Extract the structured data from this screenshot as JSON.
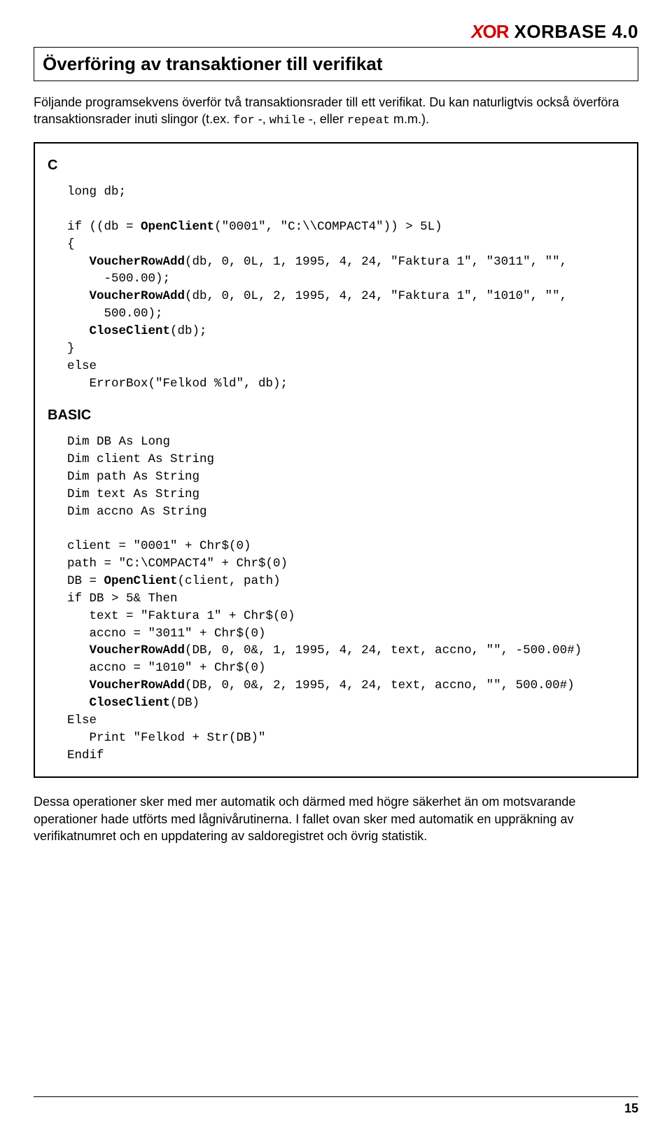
{
  "header": {
    "logo_text": "XOR",
    "product": "XORBASE 4.0"
  },
  "title": "Överföring av transaktioner till verifikat",
  "intro_prefix": "Följande programsekvens överför två transaktionsrader till ett verifikat. Du kan naturligtvis också överföra transaktionsrader inuti slingor (t.ex. ",
  "intro_tokens": {
    "for": "for",
    "while": "while",
    "repeat": "repeat"
  },
  "intro_sep1": " -, ",
  "intro_sep2": " -, eller ",
  "intro_suffix": "  m.m.).",
  "code_c_label": "C",
  "code_c": "long db;\n\nif ((db = <b>OpenClient</b>(\"0001\", \"C:\\\\COMPACT4\")) > 5L)\n{\n   <b>VoucherRowAdd</b>(db, 0, 0L, 1, 1995, 4, 24, \"Faktura 1\", \"3011\", \"\",\n     -500.00);\n   <b>VoucherRowAdd</b>(db, 0, 0L, 2, 1995, 4, 24, \"Faktura 1\", \"1010\", \"\",\n     500.00);\n   <b>CloseClient</b>(db);\n}\nelse\n   ErrorBox(\"Felkod %ld\", db);",
  "code_basic_label": "BASIC",
  "code_basic": "Dim DB As Long\nDim client As String\nDim path As String\nDim text As String\nDim accno As String\n\nclient = \"0001\" + Chr$(0)\npath = \"C:\\COMPACT4\" + Chr$(0)\nDB = <b>OpenClient</b>(client, path)\nif DB > 5& Then\n   text = \"Faktura 1\" + Chr$(0)\n   accno = \"3011\" + Chr$(0)\n   <b>VoucherRowAdd</b>(DB, 0, 0&, 1, 1995, 4, 24, text, accno, \"\", -500.00#)\n   accno = \"1010\" + Chr$(0)\n   <b>VoucherRowAdd</b>(DB, 0, 0&, 2, 1995, 4, 24, text, accno, \"\", 500.00#)\n   <b>CloseClient</b>(DB)\nElse\n   Print \"Felkod + Str(DB)\"\nEndif",
  "outro": "Dessa operationer sker med mer automatik och därmed med högre säkerhet än om motsvarande operationer hade utförts med lågnivårutinerna. I fallet ovan sker med automatik en uppräkning av verifikatnumret och en uppdatering av saldoregistret och övrig statistik.",
  "page_number": "15"
}
